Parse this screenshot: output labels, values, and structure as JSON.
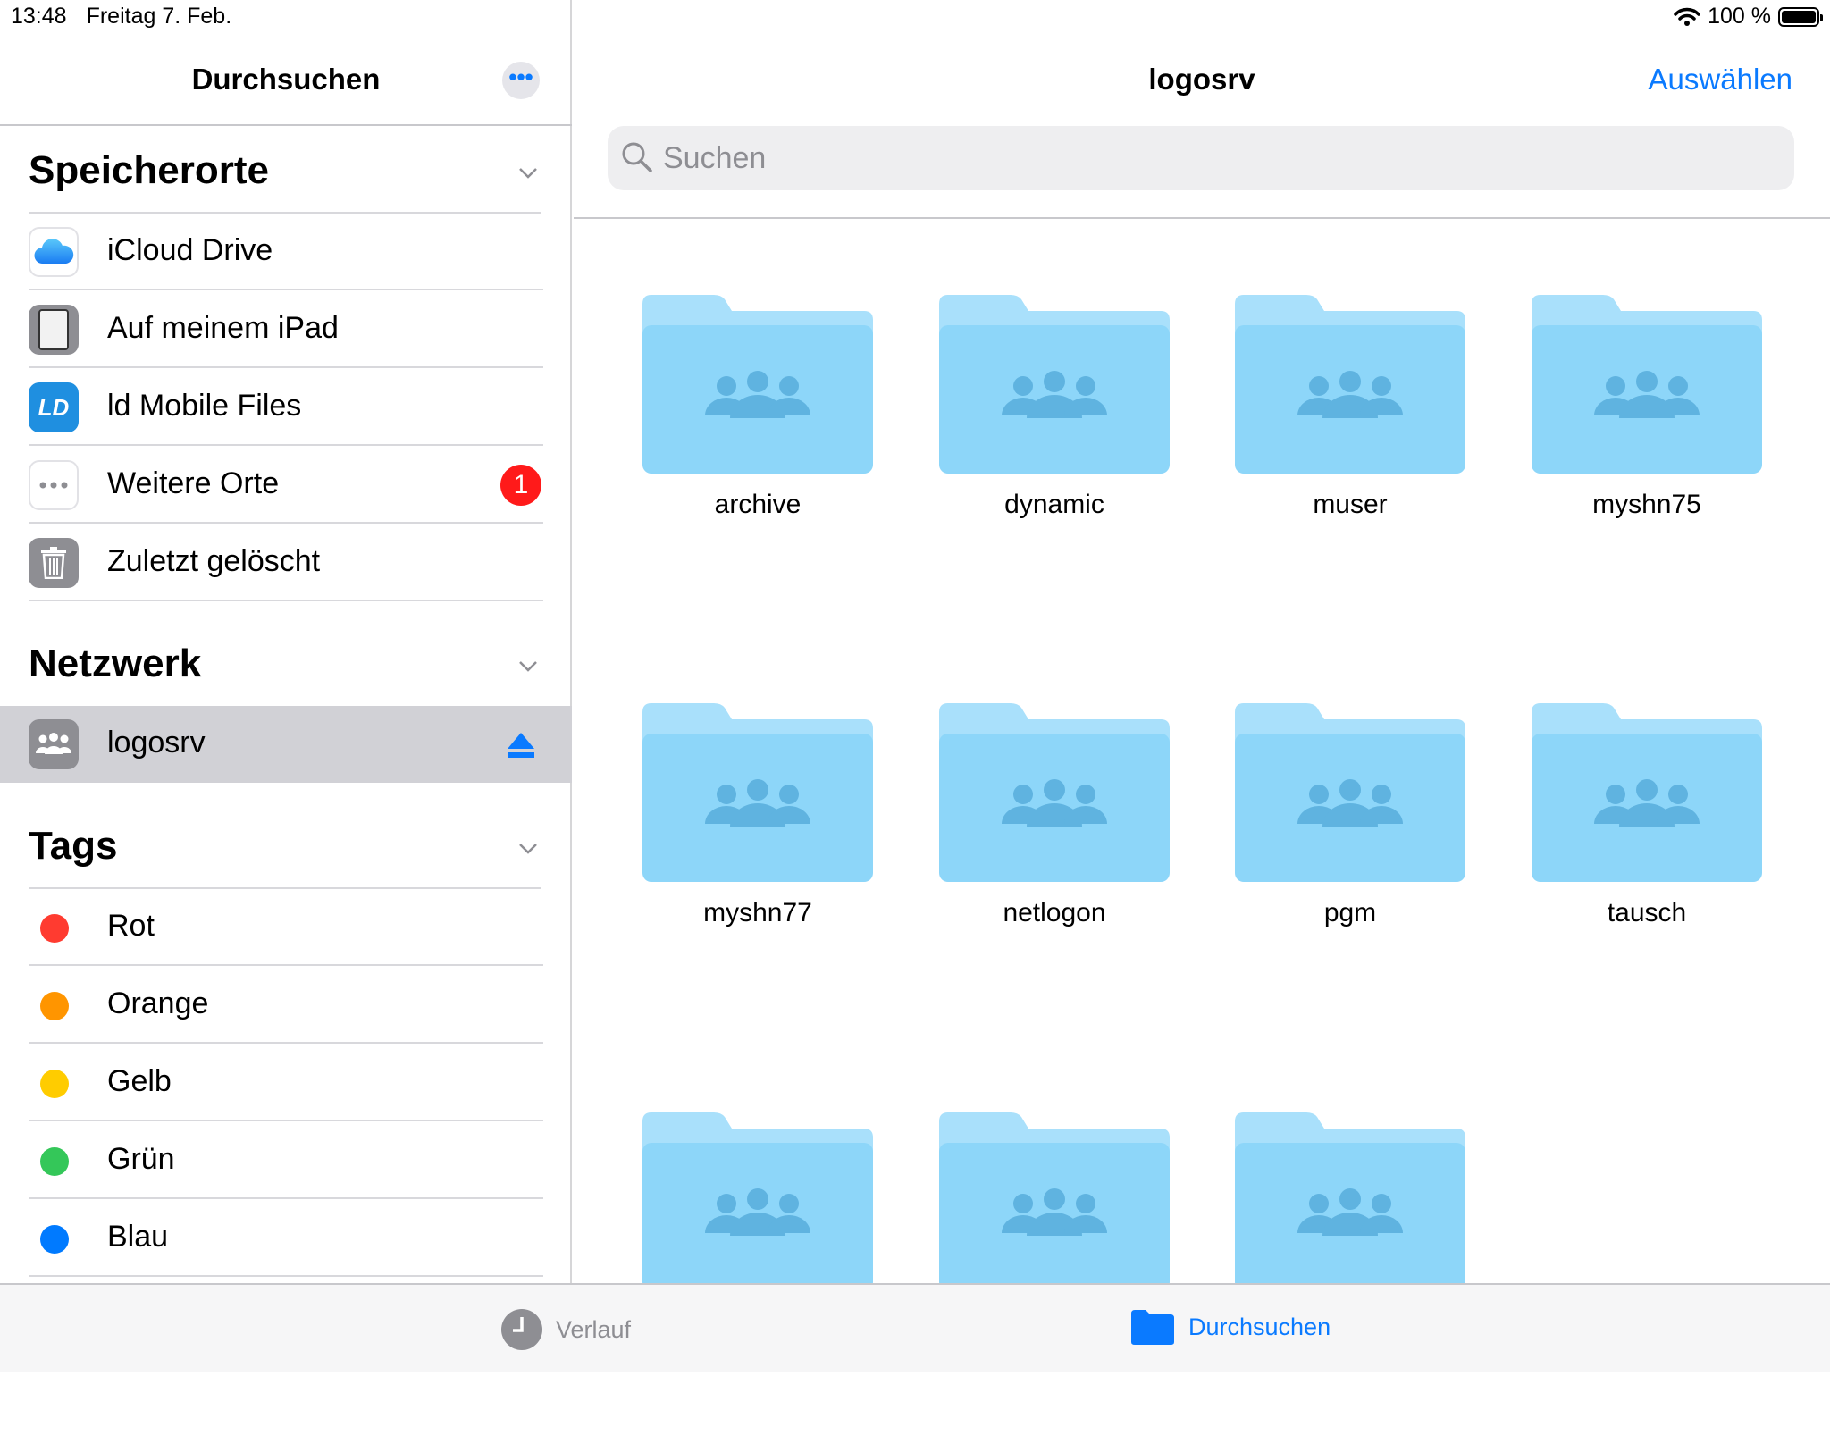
{
  "status": {
    "time": "13:48",
    "date": "Freitag 7. Feb.",
    "battery": "100 %"
  },
  "sidebar": {
    "title": "Durchsuchen",
    "more_label": "•••",
    "sections": {
      "locations": {
        "title": "Speicherorte",
        "items": [
          {
            "label": "iCloud Drive",
            "icon": "icloud-icon"
          },
          {
            "label": "Auf meinem iPad",
            "icon": "ipad-icon"
          },
          {
            "label": "ld Mobile Files",
            "icon": "ld-app-icon",
            "icon_text": "LD"
          },
          {
            "label": "Weitere Orte",
            "icon": "more-icon",
            "badge": "1"
          },
          {
            "label": "Zuletzt gelöscht",
            "icon": "trash-icon"
          }
        ]
      },
      "network": {
        "title": "Netzwerk",
        "items": [
          {
            "label": "logosrv",
            "icon": "server-icon",
            "selected": true
          }
        ]
      },
      "tags": {
        "title": "Tags",
        "items": [
          {
            "label": "Rot",
            "color": "#ff3b30"
          },
          {
            "label": "Orange",
            "color": "#ff9500"
          },
          {
            "label": "Gelb",
            "color": "#ffcc00"
          },
          {
            "label": "Grün",
            "color": "#34c759"
          },
          {
            "label": "Blau",
            "color": "#007aff"
          }
        ]
      }
    }
  },
  "main": {
    "title": "logosrv",
    "select_label": "Auswählen",
    "search_placeholder": "Suchen",
    "folders": [
      "archive",
      "dynamic",
      "muser",
      "myshn75",
      "myshn77",
      "netlogon",
      "pgm",
      "tausch",
      "",
      "",
      ""
    ]
  },
  "tabbar": {
    "recents": "Verlauf",
    "browse": "Durchsuchen"
  },
  "colors": {
    "accent": "#0a7aff",
    "folder": "#8dd6f9",
    "folder_tab": "#a9e0fb"
  }
}
